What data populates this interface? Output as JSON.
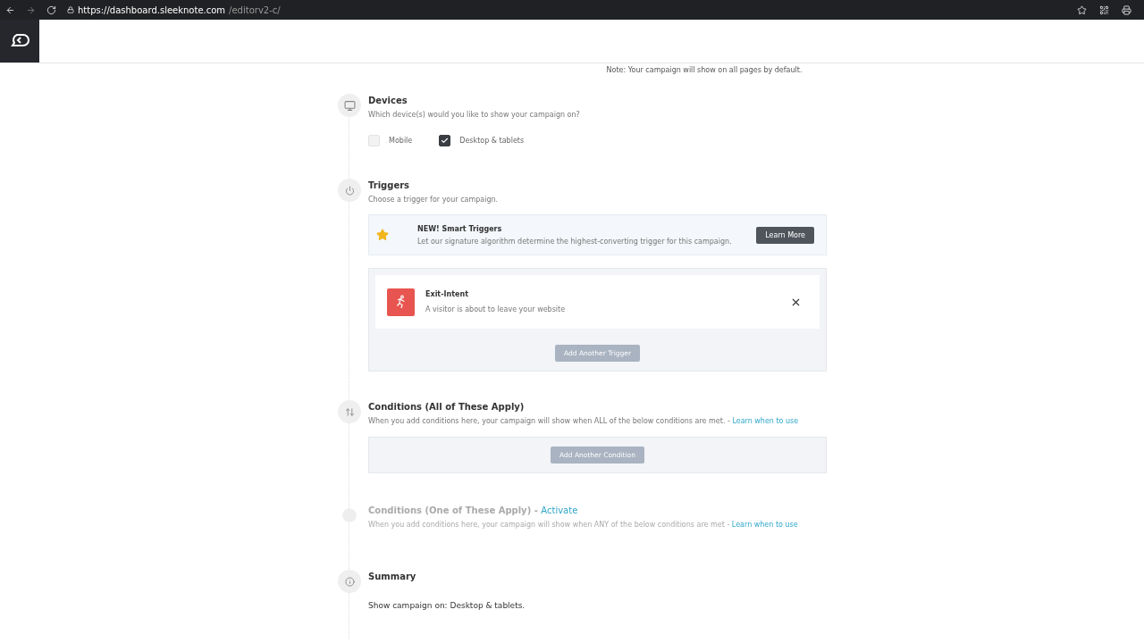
{
  "browser": {
    "url_host": "https://dashboard.sleeknote.com",
    "url_path": "/editorv2-c/"
  },
  "note": "Note: Your campaign will show on all pages by default.",
  "devices": {
    "title": "Devices",
    "subtitle": "Which device(s) would you like to show your campaign on?",
    "options": [
      {
        "label": "Mobile",
        "checked": false
      },
      {
        "label": "Desktop & tablets",
        "checked": true
      }
    ]
  },
  "triggers": {
    "title": "Triggers",
    "subtitle": "Choose a trigger for your campaign.",
    "promo": {
      "title": "NEW! Smart Triggers",
      "text": "Let our signature algorithm determine the highest-converting trigger for this campaign.",
      "button": "Learn More"
    },
    "items": [
      {
        "name": "Exit-Intent",
        "description": "A visitor is about to leave your website"
      }
    ],
    "add_button": "Add Another Trigger"
  },
  "conditions": [
    {
      "active": true,
      "title": "Conditions (All of These Apply)",
      "description": "When you add conditions here, your campaign will show when ALL of the below conditions are met. -",
      "link": "Learn when to use",
      "add_button": "Add Another Condition"
    },
    {
      "active": false,
      "title": "Conditions (One of These Apply) -",
      "activate_link": "Activate",
      "description": "When you add conditions here, your campaign will show when ANY of the below conditions are met -",
      "link": "Learn when to use"
    }
  ],
  "summary": {
    "title": "Summary",
    "text": "Show campaign on: Desktop & tablets."
  }
}
